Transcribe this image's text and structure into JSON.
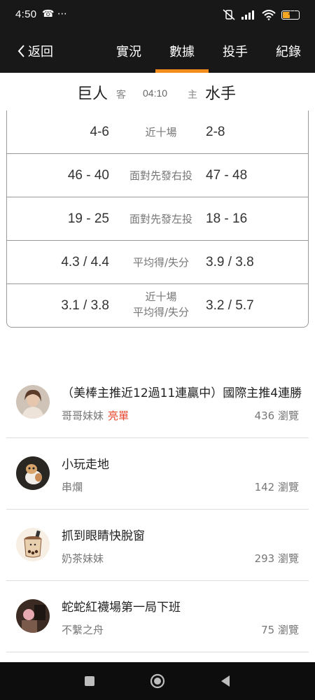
{
  "status_bar": {
    "time": "4:50",
    "left_icons": "☎ ⋯",
    "battery_level": "44"
  },
  "nav": {
    "back_label": "返回",
    "tabs": [
      {
        "label": "實況",
        "active": false
      },
      {
        "label": "數據",
        "active": true
      },
      {
        "label": "投手",
        "active": false
      },
      {
        "label": "紀錄",
        "active": false
      }
    ],
    "accent_color": "#f28c1c"
  },
  "match": {
    "away_team": "巨人",
    "away_tag": "客",
    "time": "04:10",
    "home_tag": "主",
    "home_team": "水手"
  },
  "stats": [
    {
      "away": "4-6",
      "label": "近十場",
      "home": "2-8"
    },
    {
      "away": "46 - 40",
      "label": "面對先發右投",
      "home": "47 - 48"
    },
    {
      "away": "19 - 25",
      "label": "面對先發左投",
      "home": "18 - 16"
    },
    {
      "away": "4.3 / 4.4",
      "label": "平均得/失分",
      "home": "3.9 / 3.8"
    },
    {
      "away": "3.1 / 3.8",
      "label_line1": "近十場",
      "label_line2": "平均得/失分",
      "home": "3.2 / 5.7"
    }
  ],
  "posts": [
    {
      "title": "（美棒主推近12過11連贏中）國際主推4連勝",
      "author": "哥哥妹妹",
      "badge": "亮單",
      "views": "436 瀏覽",
      "avatar": "portrait-avatar"
    },
    {
      "title": "小玩走地",
      "author": "串爛",
      "badge": "",
      "views": "142 瀏覽",
      "avatar": "dog-avatar"
    },
    {
      "title": "抓到眼睛快脫窗",
      "author": "奶茶妹妹",
      "badge": "",
      "views": "293 瀏覽",
      "avatar": "bubble-tea-avatar"
    },
    {
      "title": "蛇蛇紅襪場第一局下班",
      "author": "不繫之舟",
      "badge": "",
      "views": "75 瀏覽",
      "avatar": "photo-avatar"
    }
  ]
}
